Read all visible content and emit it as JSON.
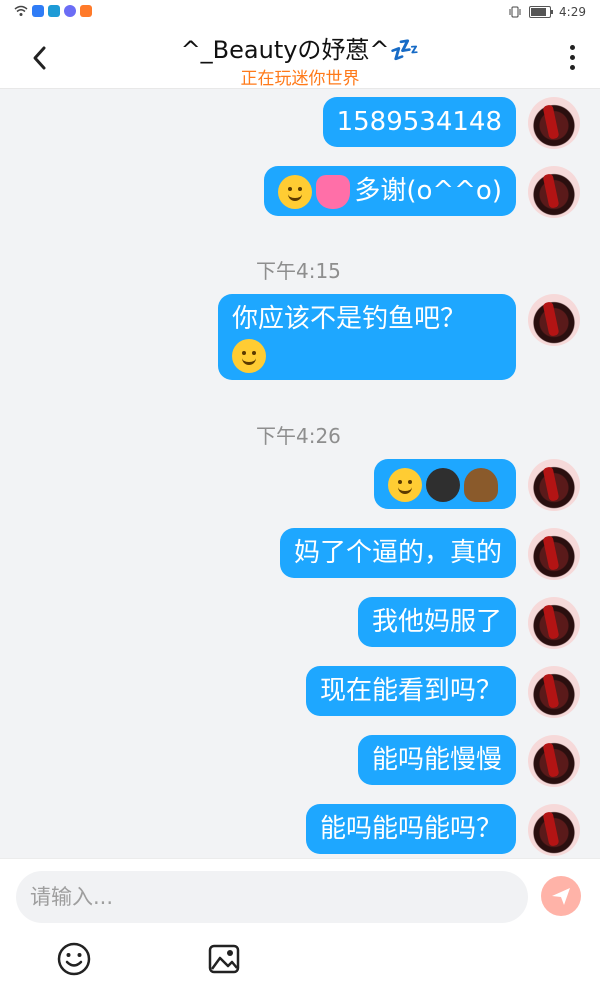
{
  "statusbar": {
    "time": "4:29",
    "battery_level": 0.85
  },
  "header": {
    "title": "^_Beautyの妤蒽^💤",
    "subtitle": "正在玩迷你世界"
  },
  "messages": [
    {
      "type": "message",
      "text": "1589534148"
    },
    {
      "type": "message",
      "text": "多谢(o^^o)",
      "emojis": [
        "drooling-face",
        "revolving-hearts"
      ]
    },
    {
      "type": "time",
      "text": "下午4:15"
    },
    {
      "type": "message",
      "text": "你应该不是钓鱼吧？",
      "emojis_after": [
        "sweat-smile"
      ]
    },
    {
      "type": "time",
      "text": "下午4:26"
    },
    {
      "type": "message",
      "text": "",
      "emojis": [
        "smirk-face",
        "dark-face",
        "poop"
      ]
    },
    {
      "type": "message",
      "text": "妈了个逼的，真的"
    },
    {
      "type": "message",
      "text": "我他妈服了"
    },
    {
      "type": "message",
      "text": "现在能看到吗？"
    },
    {
      "type": "message",
      "text": "能吗能慢慢"
    },
    {
      "type": "message",
      "text": "能吗能吗能吗？"
    }
  ],
  "composer": {
    "placeholder": "请输入..."
  },
  "colors": {
    "bubble": "#1ea7ff",
    "subtitle": "#ff7a1a",
    "send": "#ffb3a8",
    "background": "#f2f3f5"
  }
}
